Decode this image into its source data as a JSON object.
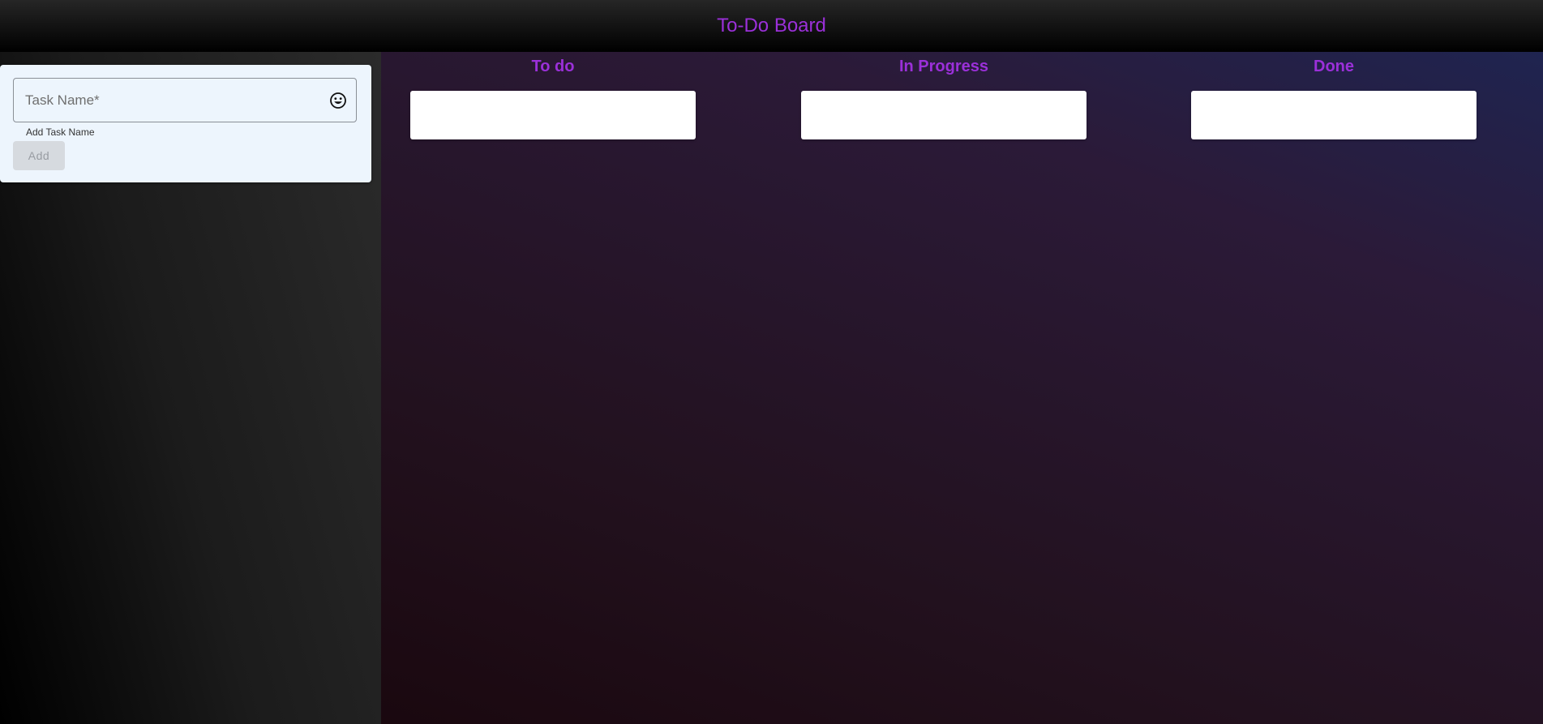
{
  "header": {
    "title": "To-Do Board"
  },
  "task_form": {
    "input_placeholder": "Task Name*",
    "input_value": "",
    "emoji_icon": "smiley-face-icon",
    "helper_text": "Add Task Name",
    "add_label": "Add"
  },
  "columns": [
    {
      "title": "To do"
    },
    {
      "title": "In Progress"
    },
    {
      "title": "Done"
    }
  ],
  "colors": {
    "accent": "#9b30d9",
    "card_background": "#edf5fd"
  }
}
